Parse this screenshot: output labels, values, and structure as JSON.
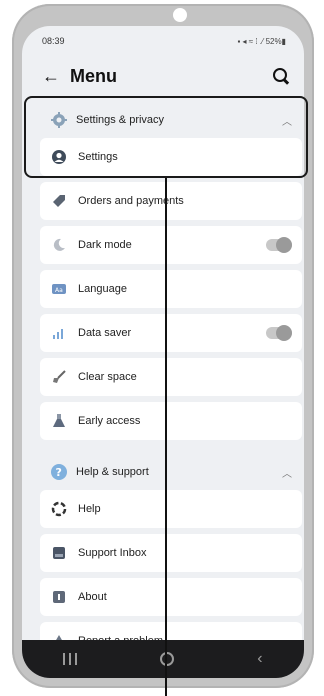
{
  "status": {
    "time": "08:39",
    "icons": "▪ ◂ ≈ ⁞ .⁄ 52%▮"
  },
  "header": {
    "back": "←",
    "title": "Menu"
  },
  "sections": [
    {
      "label": "Settings & privacy",
      "icon": "gear-icon",
      "items": [
        {
          "label": "Settings",
          "icon": "person-icon"
        },
        {
          "label": "Orders and payments",
          "icon": "tag-icon"
        },
        {
          "label": "Dark mode",
          "icon": "moon-icon",
          "toggle": false
        },
        {
          "label": "Language",
          "icon": "language-icon"
        },
        {
          "label": "Data saver",
          "icon": "signal-icon",
          "toggle": false
        },
        {
          "label": "Clear space",
          "icon": "broom-icon"
        },
        {
          "label": "Early access",
          "icon": "flask-icon"
        }
      ]
    },
    {
      "label": "Help & support",
      "icon": "question-icon",
      "items": [
        {
          "label": "Help",
          "icon": "lifebuoy-icon"
        },
        {
          "label": "Support Inbox",
          "icon": "inbox-icon"
        },
        {
          "label": "About",
          "icon": "info-icon"
        },
        {
          "label": "Report a problem",
          "icon": "warning-icon"
        }
      ]
    }
  ],
  "colors": {
    "screen_bg": "#eef0f3",
    "card": "#ffffff",
    "outline": "#1a1a1a",
    "navbar": "#1c1c1e"
  }
}
